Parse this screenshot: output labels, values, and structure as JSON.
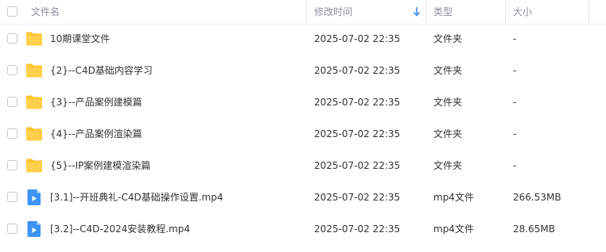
{
  "header": {
    "name": "文件名",
    "modified": "修改时间",
    "type": "类型",
    "size": "大小"
  },
  "sort": {
    "column": "modified",
    "direction": "descending",
    "icon": "arrow-down-icon"
  },
  "colors": {
    "folder": "#FFC533",
    "video": "#3D94F6",
    "sort_arrow": "#3D8BF2"
  },
  "rows": [
    {
      "name": "10期课堂文件",
      "modified": "2025-07-02 22:35",
      "type": "文件夹",
      "size": "-",
      "icon": "folder-icon"
    },
    {
      "name": "{2}--C4D基础内容学习",
      "modified": "2025-07-02 22:35",
      "type": "文件夹",
      "size": "-",
      "icon": "folder-icon"
    },
    {
      "name": "{3}--产品案例建模篇",
      "modified": "2025-07-02 22:35",
      "type": "文件夹",
      "size": "-",
      "icon": "folder-icon"
    },
    {
      "name": "{4}--产品案例渲染篇",
      "modified": "2025-07-02 22:35",
      "type": "文件夹",
      "size": "-",
      "icon": "folder-icon"
    },
    {
      "name": "{5}--IP案例建模渲染篇",
      "modified": "2025-07-02 22:35",
      "type": "文件夹",
      "size": "-",
      "icon": "folder-icon"
    },
    {
      "name": "[3.1]--开班典礼-C4D基础操作设置.mp4",
      "modified": "2025-07-02 22:35",
      "type": "mp4文件",
      "size": "266.53MB",
      "icon": "video-file-icon"
    },
    {
      "name": "[3.2]--C4D-2024安装教程.mp4",
      "modified": "2025-07-02 22:35",
      "type": "mp4文件",
      "size": "28.65MB",
      "icon": "video-file-icon"
    }
  ]
}
